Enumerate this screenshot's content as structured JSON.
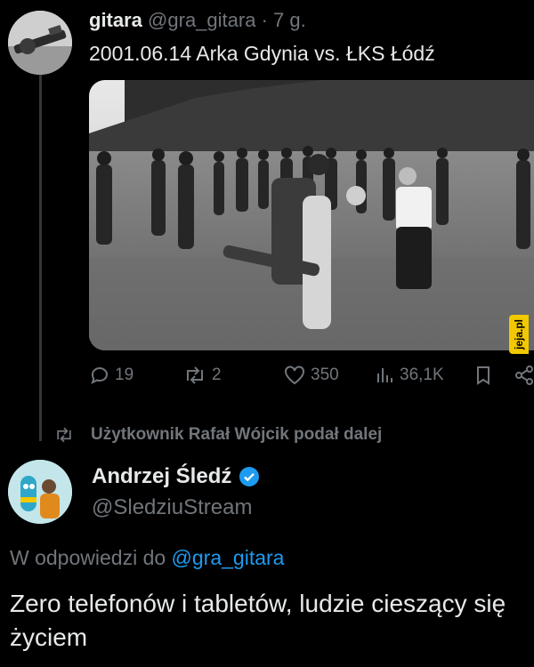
{
  "top_tweet": {
    "display_name": "gitara",
    "handle": "@gra_gitara",
    "separator": " · ",
    "time": "7 g.",
    "text": "2001.06.14 Arka Gdynia vs. ŁKS Łódź",
    "actions": {
      "replies": "19",
      "reposts": "2",
      "likes": "350",
      "views": "36,1K"
    }
  },
  "watermark": "jeja.pl",
  "retweet_note": "Użytkownik Rafał Wójcik podał dalej",
  "reply": {
    "display_name": "Andrzej Śledź",
    "handle": "@SledziuStream",
    "in_reply_prefix": "W odpowiedzi do ",
    "in_reply_mention": "@gra_gitara",
    "text": "Zero telefonów i tabletów, ludzie cieszący się życiem"
  },
  "colors": {
    "background": "#000000",
    "text": "#e7e9ea",
    "muted": "#71767b",
    "link": "#1d9bf0",
    "verified": "#1d9bf0",
    "watermark": "#f2c800"
  }
}
